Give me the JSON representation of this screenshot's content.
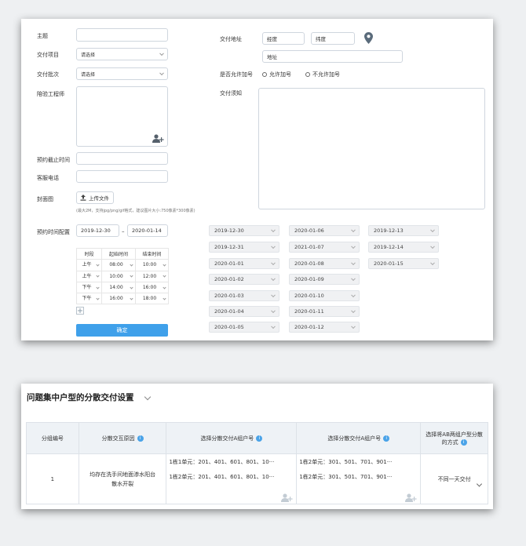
{
  "form": {
    "subject_label": "主题",
    "subject_value": "",
    "project_label": "交付项目",
    "project_value": "请选择",
    "batch_label": "交付批次",
    "batch_value": "请选择",
    "engineer_label": "陪验工程师",
    "deadline_label": "预约截止时间",
    "deadline_value": "",
    "phone_label": "客服电话",
    "phone_value": "",
    "cover_label": "封面图",
    "upload_label": "上传文件",
    "upload_hint": "(最大2M，支持jpg/png/gif格式，建议图片大小:750像素*300像素)",
    "address_label": "交付地址",
    "longitude_placeholder": "经度",
    "latitude_placeholder": "纬度",
    "address_placeholder": "地址",
    "extra_label": "是否允许加号",
    "allow_label": "允许加号",
    "disallow_label": "不允许加号",
    "notice_label": "交付须知",
    "notice_value": "",
    "time_config_label": "预约时间配置",
    "range_start": "2019-12-30",
    "range_sep": "–",
    "range_end": "2020-01-14",
    "confirm_label": "确定"
  },
  "slot_table": {
    "headers": [
      "时段",
      "起始时间",
      "结束时间"
    ],
    "rows": [
      {
        "period": "上午",
        "start": "08:00",
        "end": "10:00"
      },
      {
        "period": "上午",
        "start": "10:00",
        "end": "12:00"
      },
      {
        "period": "下午",
        "start": "14:00",
        "end": "16:00"
      },
      {
        "period": "下午",
        "start": "16:00",
        "end": "18:00"
      }
    ]
  },
  "dates": {
    "col1": [
      "2019-12-30",
      "2019-12-31",
      "2020-01-01",
      "2020-01-02",
      "2020-01-03",
      "2020-01-04",
      "2020-01-05"
    ],
    "col2": [
      "2020-01-06",
      "2021-01-07",
      "2020-01-08",
      "2020-01-09",
      "2020-01-10",
      "2020-01-11",
      "2020-01-12"
    ],
    "col3": [
      "2019-12-13",
      "2019-12-14",
      "2020-01-15"
    ]
  },
  "section2": {
    "title": "问题集中户型的分散交付设置",
    "headers": [
      "分组编号",
      "分散交互原因",
      "选择分散交付A组户号",
      "选择分散交付A组户号",
      "选择将AB两组户型分散的方式"
    ],
    "row": {
      "id": "1",
      "reason": "均存在洗手间地面渗水阳台散水开裂",
      "group_a": [
        "1栋1单元：201、401、601、801、10···",
        "1栋2单元：201、401、601、801、10···"
      ],
      "group_b": [
        "1栋2单元：301、501、701、901···",
        "1栋2单元：301、501、701、901···"
      ],
      "method": "不同一天交付"
    }
  },
  "colors": {
    "accent": "#3fa0ea",
    "pin": "#5a6b7b",
    "border": "#cfd6de"
  }
}
